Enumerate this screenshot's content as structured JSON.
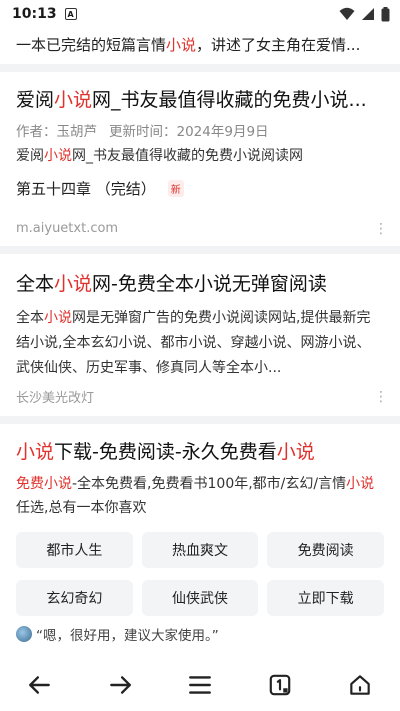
{
  "status": {
    "time": "10:13",
    "a_badge": "A"
  },
  "top_snippet": {
    "prefix": "一本已完结的短篇言情",
    "hl": "小说",
    "suffix": "，讲述了女主角在爱情..."
  },
  "result1": {
    "title_a": "爱阅",
    "title_hl": "小说",
    "title_b": "网_书友最值得收藏的免费小说...",
    "author": "作者：玉胡芦",
    "updated": "更新时间：2024年9月9日",
    "desc_a": "爱阅",
    "desc_hl": "小说",
    "desc_b": "网_书友最值得收藏的免费小说阅读网",
    "chapter": "第五十四章 （完结）",
    "new_tag": "新",
    "source": "m.aiyuetxt.com"
  },
  "result2": {
    "title_a": "全本",
    "title_hl": "小说",
    "title_b": "网-免费全本小说无弹窗阅读",
    "desc_a": "全本",
    "desc_hl": "小说",
    "desc_b": "网是无弹窗广告的免费小说阅读网站,提供最新完结小说,全本玄幻小说、都市小说、穿越小说、网游小说、武侠仙侠、历史军事、修真同人等全本小...",
    "source": "长沙美光改灯"
  },
  "result3": {
    "title_hl1": "小说",
    "title_mid": "下载-免费阅读-永久免费看",
    "title_hl2": "小说",
    "desc_hl1": "免费小说",
    "desc_mid": "-全本免费看,免费看书100年,都市/玄幻/言情",
    "desc_hl2": "小说",
    "desc_end": "任选,总有一本你喜欢",
    "tags": [
      "都市人生",
      "热血爽文",
      "免费阅读",
      "玄幻奇幻",
      "仙侠武侠",
      "立即下载"
    ],
    "quote": "“嗯，很好用，建议大家使用。”"
  }
}
